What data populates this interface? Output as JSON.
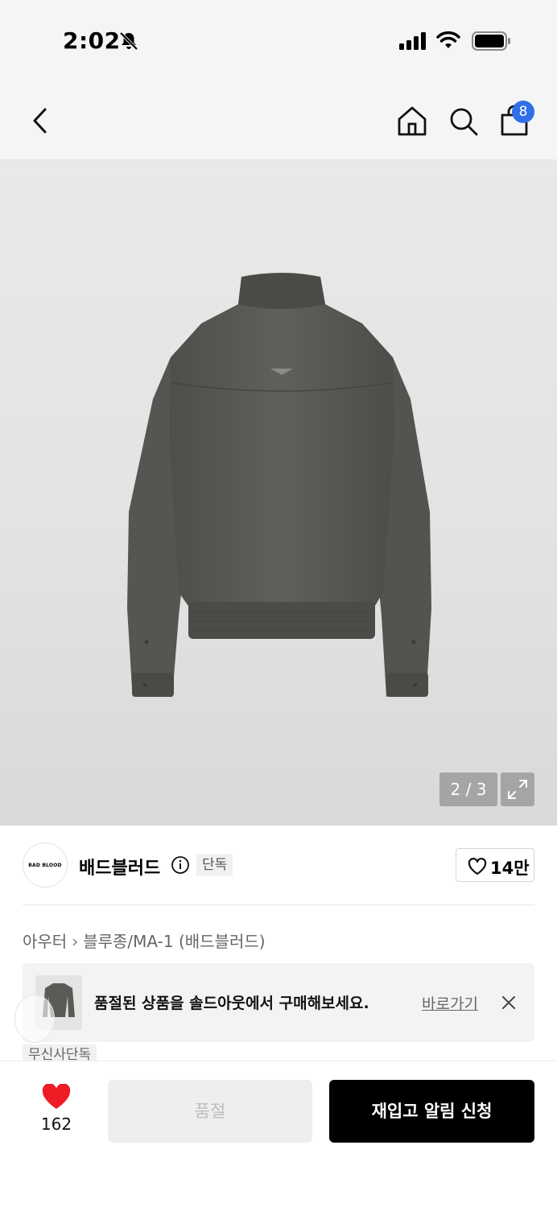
{
  "status_bar": {
    "time": "2:02"
  },
  "header": {
    "cart_badge": "8"
  },
  "gallery": {
    "page_indicator": "2 / 3",
    "accent_background": "#e5e5e5"
  },
  "brand": {
    "name": "배드블러드",
    "logo_text": "BAD BLOOD",
    "exclusive_badge": "단독",
    "like_count": "14만"
  },
  "breadcrumb": {
    "category": "아우터",
    "subcategory": "블루종/MA-1 (배드블러드)"
  },
  "soldout_banner": {
    "message": "품절된 상품을 솔드아웃에서 구매해보세요.",
    "link_label": "바로가기"
  },
  "peek_tag": "무신사단독",
  "bottom_bar": {
    "wish_count": "162",
    "soldout_label": "품절",
    "restock_label": "재입고 알림 신청",
    "heart_color": "#ee1c25",
    "primary_color": "#000000"
  },
  "icons": [
    "back-arrow-icon",
    "home-icon",
    "search-icon",
    "shopping-bag-icon",
    "bell-off-icon",
    "signal-icon",
    "wifi-icon",
    "battery-icon",
    "info-icon",
    "heart-outline-icon",
    "expand-icon",
    "close-icon",
    "heart-filled-icon"
  ]
}
